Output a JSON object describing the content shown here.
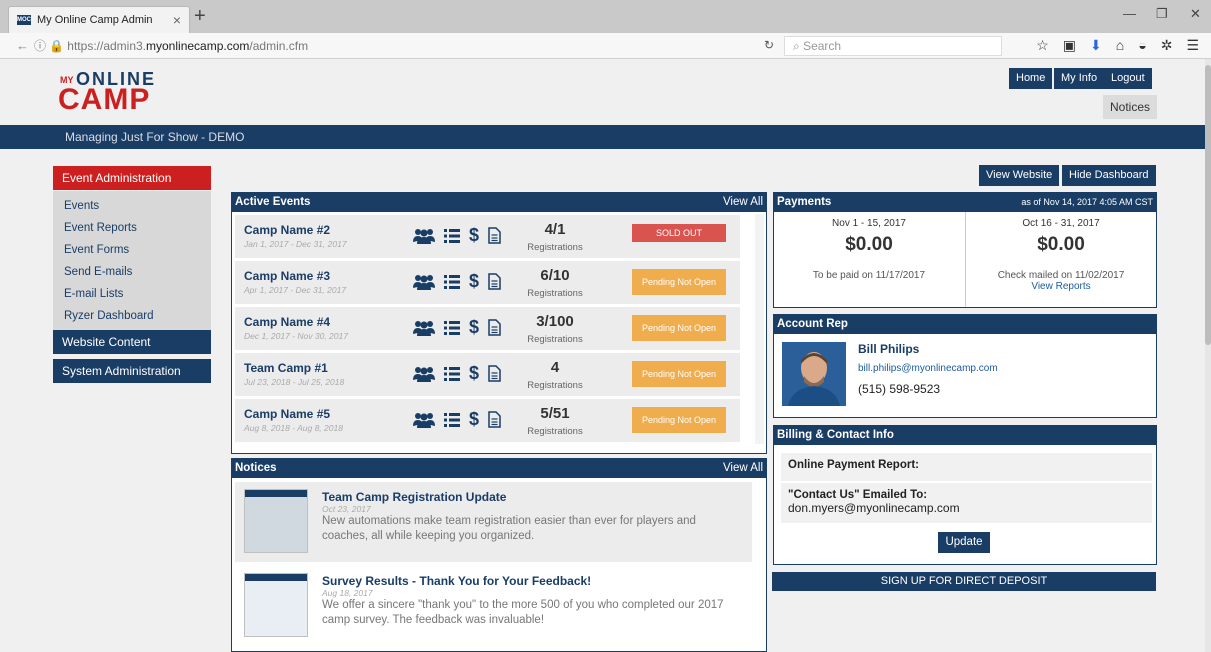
{
  "browser": {
    "tab_title": "My Online Camp Admin",
    "favicon_text": "MOC",
    "url_prefix": "https://admin3.",
    "url_host": "myonlinecamp.com",
    "url_path": "/admin.cfm",
    "search_placeholder": "Search"
  },
  "header": {
    "logo_my": "MY",
    "logo_online": "ONLINE",
    "logo_camp": "CAMP",
    "buttons": {
      "home": "Home",
      "my_info": "My Info",
      "logout": "Logout"
    },
    "notices": "Notices",
    "managing": "Managing Just For Show - DEMO",
    "view_website": "View Website",
    "hide_dashboard": "Hide Dashboard"
  },
  "sidebar": {
    "active_section": "Event Administration",
    "items": [
      "Events",
      "Event Reports",
      "Event Forms",
      "Send E-mails",
      "E-mail Lists",
      "Ryzer Dashboard"
    ],
    "sections": [
      "Website Content",
      "System Administration"
    ]
  },
  "active_events": {
    "title": "Active Events",
    "view_all": "View All",
    "rows": [
      {
        "name": "Camp Name #2",
        "dates": "Jan 1, 2017 - Dec 31, 2017",
        "count": "4/1",
        "reg": "Registrations",
        "status": "SOLD OUT",
        "status_type": "sold"
      },
      {
        "name": "Camp Name #3",
        "dates": "Apr 1, 2017 - Dec 31, 2017",
        "count": "6/10",
        "reg": "Registrations",
        "status": "Pending Not Open",
        "status_type": "pending"
      },
      {
        "name": "Camp Name #4",
        "dates": "Dec 1, 2017 - Nov 30, 2017",
        "count": "3/100",
        "reg": "Registrations",
        "status": "Pending Not Open",
        "status_type": "pending"
      },
      {
        "name": "Team Camp #1",
        "dates": "Jul 23, 2018 - Jul 25, 2018",
        "count": "4",
        "reg": "Registrations",
        "status": "Pending Not Open",
        "status_type": "pending"
      },
      {
        "name": "Camp Name #5",
        "dates": "Aug 8, 2018 - Aug 8, 2018",
        "count": "5/51",
        "reg": "Registrations",
        "status": "Pending Not Open",
        "status_type": "pending"
      }
    ]
  },
  "notices": {
    "title": "Notices",
    "view_all": "View All",
    "items": [
      {
        "title": "Team Camp Registration Update",
        "date": "Oct 23, 2017",
        "text": "New automations make team registration easier than ever for players and coaches, all while keeping you organized."
      },
      {
        "title": "Survey Results - Thank You for Your Feedback!",
        "date": "Aug 18, 2017",
        "text": "We offer a sincere \"thank you\" to the more 500 of you who completed our 2017 camp survey. The feedback was invaluable!"
      }
    ]
  },
  "payments": {
    "title": "Payments",
    "as_of": "as of Nov 14, 2017 4:05 AM CST",
    "cols": [
      {
        "range": "Nov 1 - 15, 2017",
        "amount": "$0.00",
        "note": "To be paid on 11/17/2017",
        "link": ""
      },
      {
        "range": "Oct 16 - 31, 2017",
        "amount": "$0.00",
        "note": "Check mailed on 11/02/2017",
        "link": "View Reports"
      }
    ]
  },
  "account_rep": {
    "title": "Account Rep",
    "name": "Bill Philips",
    "email": "bill.philips@myonlinecamp.com",
    "phone": "(515) 598-9523"
  },
  "billing": {
    "title": "Billing & Contact Info",
    "payment_report_label": "Online Payment Report:",
    "contact_label": "\"Contact Us\" Emailed To:",
    "contact_email": "don.myers@myonlinecamp.com",
    "update": "Update",
    "direct_deposit": "SIGN UP FOR DIRECT DEPOSIT"
  },
  "colors": {
    "navy": "#1a3d66",
    "red": "#cc1f1f",
    "sold_out": "#d9534f",
    "pending": "#f0ad4e"
  }
}
